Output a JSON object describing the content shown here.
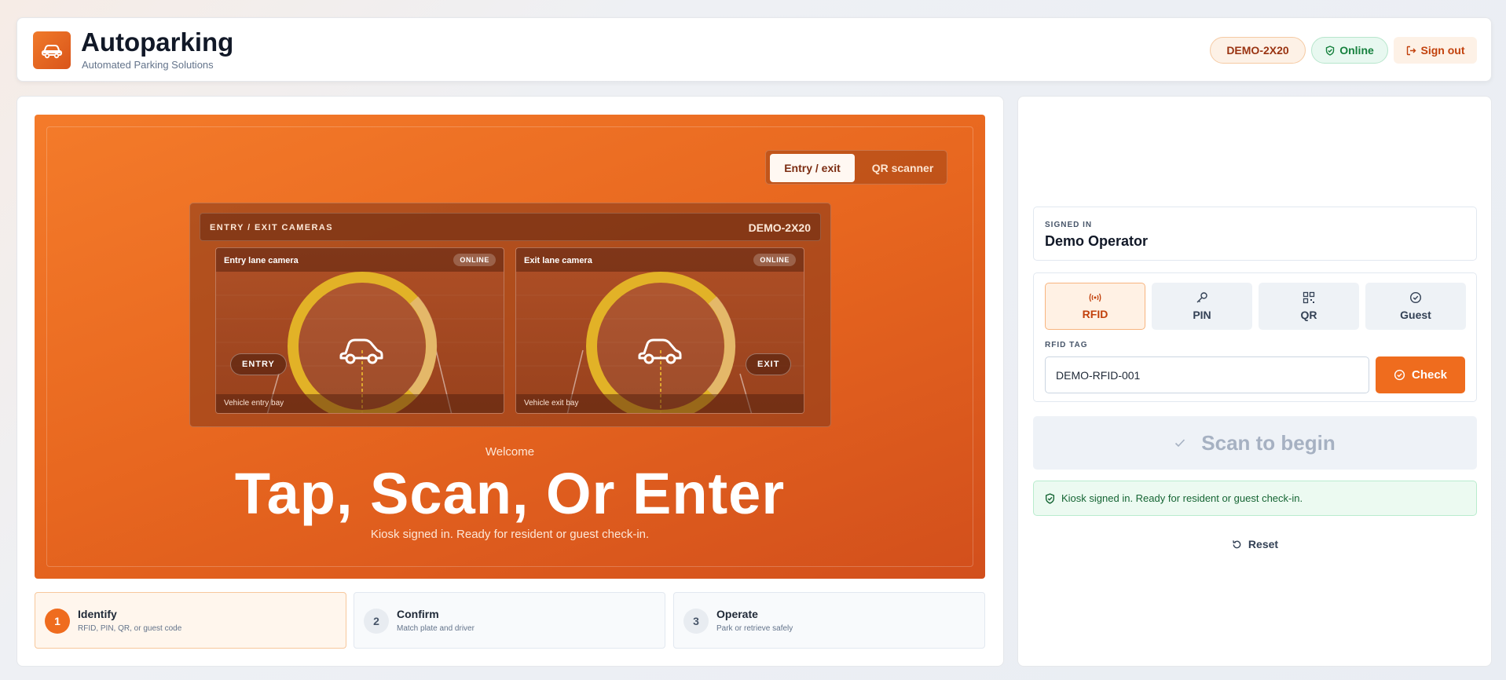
{
  "header": {
    "app_title": "Autoparking",
    "app_subtitle": "Automated Parking Solutions",
    "kiosk_id": "DEMO-2X20",
    "status": "Online",
    "signout_label": "Sign out"
  },
  "hero": {
    "tabs": [
      {
        "label": "Entry / exit",
        "active": true
      },
      {
        "label": "QR scanner",
        "active": false
      }
    ],
    "cameras_heading": "ENTRY / EXIT CAMERAS",
    "cameras_kiosk_id": "DEMO-2X20",
    "cameras": [
      {
        "title": "Entry lane camera",
        "status": "ONLINE",
        "lane_tag": "ENTRY",
        "caption": "Vehicle entry bay"
      },
      {
        "title": "Exit lane camera",
        "status": "ONLINE",
        "lane_tag": "EXIT",
        "caption": "Vehicle exit bay"
      }
    ],
    "welcome": "Welcome",
    "title": "Tap, Scan, Or Enter",
    "subtitle": "Kiosk signed in. Ready for resident or guest check-in."
  },
  "steps": [
    {
      "number": "1",
      "title": "Identify",
      "desc": "RFID, PIN, QR, or guest code",
      "active": true
    },
    {
      "number": "2",
      "title": "Confirm",
      "desc": "Match plate and driver",
      "active": false
    },
    {
      "number": "3",
      "title": "Operate",
      "desc": "Park or retrieve safely",
      "active": false
    }
  ],
  "sidebar": {
    "signed_in_label": "SIGNED IN",
    "operator_name": "Demo Operator",
    "methods": [
      {
        "label": "RFID",
        "icon": "rfid-icon",
        "active": true
      },
      {
        "label": "PIN",
        "icon": "key-icon",
        "active": false
      },
      {
        "label": "QR",
        "icon": "qr-icon",
        "active": false
      },
      {
        "label": "Guest",
        "icon": "check-circle-icon",
        "active": false
      }
    ],
    "rfid_label": "RFID TAG",
    "rfid_value": "DEMO-RFID-001",
    "check_label": "Check",
    "scan_label": "Scan to begin",
    "status_message": "Kiosk signed in. Ready for resident or guest check-in.",
    "reset_label": "Reset"
  },
  "colors": {
    "accent": "#ef6c1e",
    "online_green": "#15803d",
    "hero_gradient_start": "#f47b2a",
    "hero_gradient_end": "#d24f1c"
  }
}
